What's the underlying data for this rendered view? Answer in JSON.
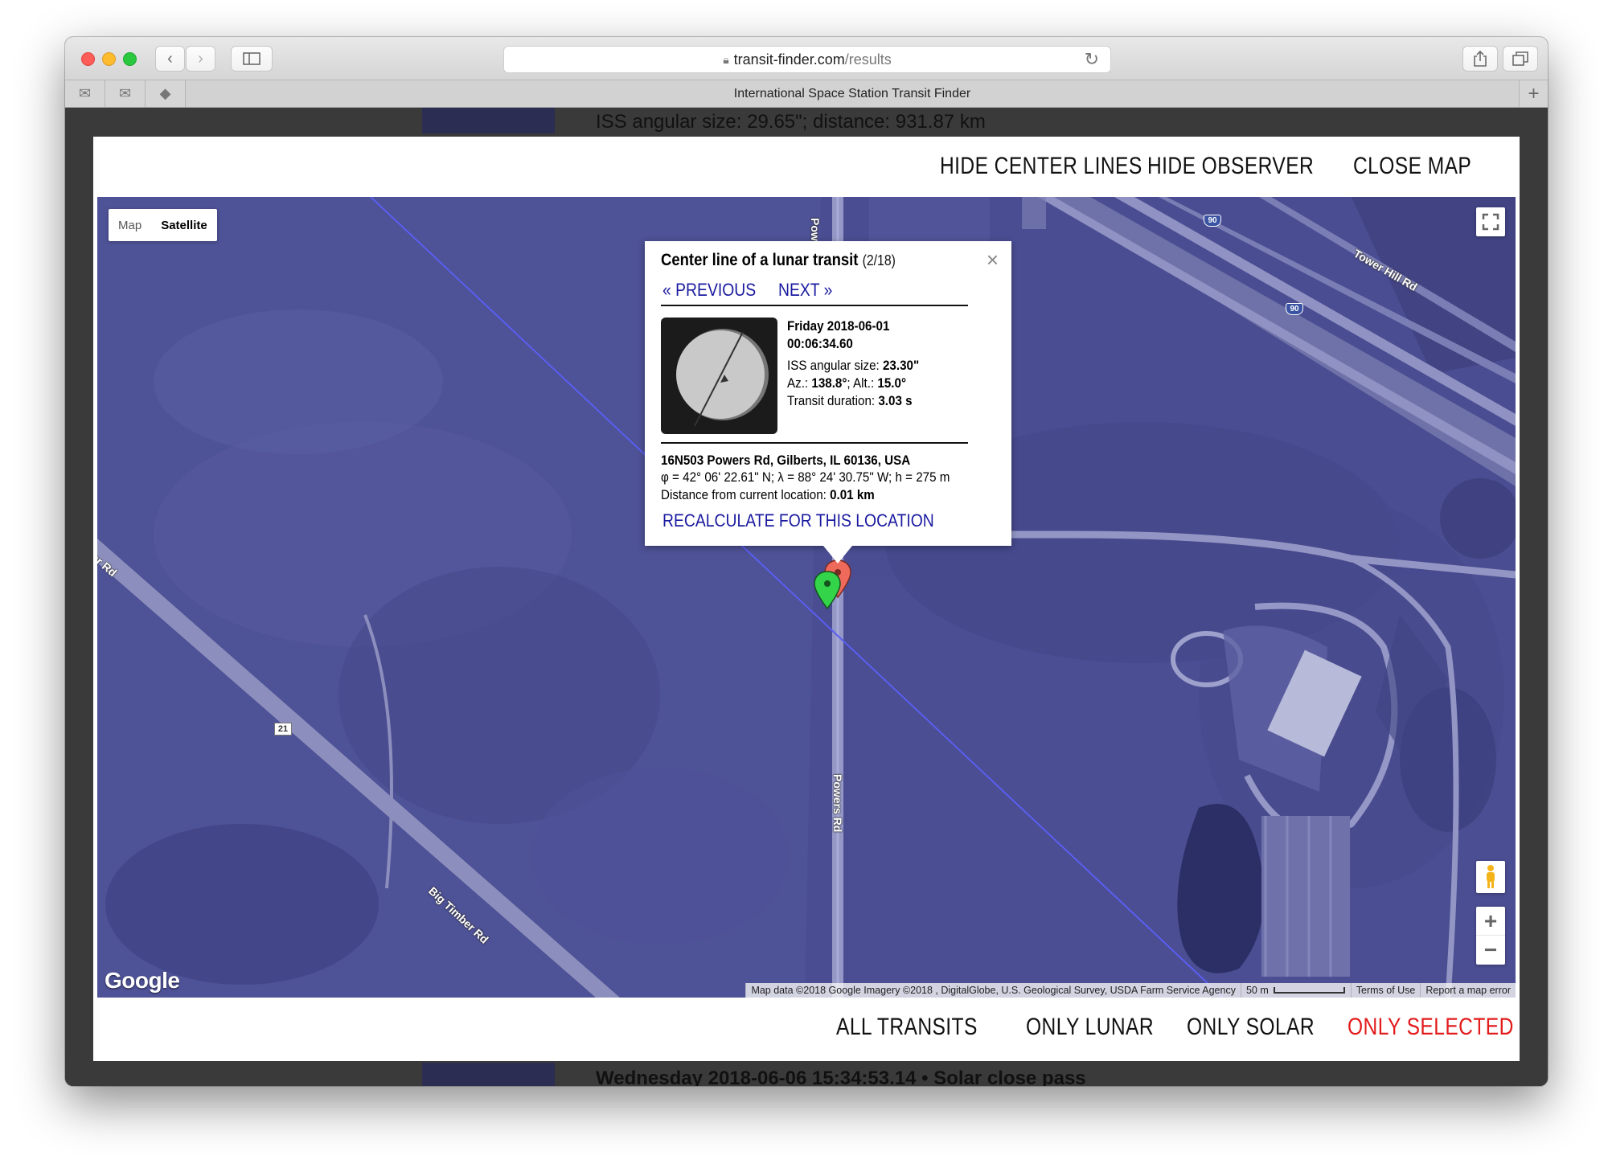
{
  "browser": {
    "url_domain": "transit-finder.com",
    "url_path": "/results",
    "tab_title": "International Space Station Transit Finder"
  },
  "background_page": {
    "top_text": "ISS angular size: 29.65\"; distance: 931.87 km",
    "bottom_text": "Wednesday 2018-06-06 15:34:53.14 • Solar close pass"
  },
  "top_actions": [
    "HIDE CENTER LINES",
    "HIDE OBSERVER",
    "CLOSE MAP"
  ],
  "bottom_filters": [
    {
      "label": "ALL TRANSITS",
      "color": "#111111"
    },
    {
      "label": "ONLY LUNAR",
      "color": "#111111"
    },
    {
      "label": "ONLY SOLAR",
      "color": "#111111"
    },
    {
      "label": "ONLY SELECTED",
      "color": "#e21b1b"
    }
  ],
  "map": {
    "map_type": {
      "map": "Map",
      "satellite": "Satellite",
      "selected": "Satellite"
    },
    "road_labels": {
      "powers_top": "Powers R",
      "powers_mid": "Powers Rd",
      "tower_hill": "Tower Hill Rd",
      "big_timber": "Big Timber Rd",
      "er_rd": "er Rd"
    },
    "route_shields": {
      "i90_a": "90",
      "i90_b": "90",
      "rt21": "21"
    },
    "logo": "Google",
    "attribution": "Map data ©2018 Google Imagery ©2018 , DigitalGlobe, U.S. Geological Survey, USDA Farm Service Agency",
    "scale_label": "50 m",
    "terms": "Terms of Use",
    "report": "Report a map error",
    "zoom_in": "+",
    "zoom_out": "−"
  },
  "info_window": {
    "title": "Center line of a lunar transit",
    "count": "(2/18)",
    "prev_label": "« PREVIOUS",
    "next_label": "NEXT »",
    "date": "Friday 2018-06-01",
    "time": "00:06:34.60",
    "iss_size_label": "ISS angular size: ",
    "iss_size_value": "23.30\"",
    "az_label": "Az.: ",
    "az_value": "138.8°",
    "alt_label": "; Alt.: ",
    "alt_value": "15.0°",
    "duration_label": "Transit duration: ",
    "duration_value": "3.03 s",
    "address": "16N503 Powers Rd, Gilberts, IL 60136, USA",
    "coords": "φ = 42° 06' 22.61\" N; λ = 88° 24' 30.75\" W; h = 275 m",
    "distance_label": "Distance from current location: ",
    "distance_value": "0.01 km",
    "recalc_label": "RECALCULATE FOR THIS LOCATION"
  },
  "colors": {
    "map_tint": "#4c4f95",
    "link_blue": "#1a1aa0",
    "center_line": "#5a5ef0",
    "marker_green": "#33d44a",
    "marker_red": "#f06a5c"
  }
}
